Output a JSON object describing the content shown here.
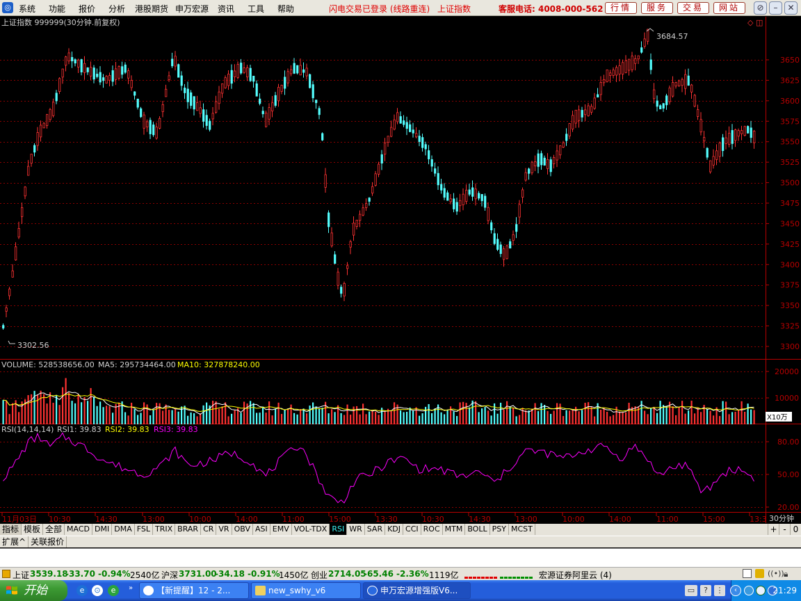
{
  "menubar": {
    "items": [
      "系统",
      "功能",
      "报价",
      "分析",
      "港股期货",
      "申万宏源",
      "资讯",
      "工具",
      "帮助"
    ],
    "flash_status": "闪电交易已登录 (线路重连)",
    "index_name": "上证指数",
    "hotline": "客服电话: 4008-000-562",
    "nav_buttons": [
      "行情",
      "服务",
      "交易",
      "网站"
    ]
  },
  "main_chart": {
    "title": "上证指数 999999(30分钟.前复权)",
    "high_label": "3684.57",
    "low_label": "3302.56",
    "y_ticks": [
      "3650",
      "3625",
      "3600",
      "3575",
      "3550",
      "3525",
      "3500",
      "3475",
      "3450",
      "3425",
      "3400",
      "3375",
      "3350",
      "3325",
      "3300"
    ]
  },
  "volume_panel": {
    "label": "VOLUME: 528538656.00",
    "ma5": "MA5: 295734464.00",
    "ma10": "MA10: 327878240.00",
    "y_ticks": [
      "20000",
      "10000"
    ],
    "unit": "X10万"
  },
  "rsi_panel": {
    "label": "RSI(14,14,14)",
    "rsi1": "RSI1: 39.83",
    "rsi2": "RSI2: 39.83",
    "rsi3": "RSI3: 39.83",
    "y_ticks": [
      "80.00",
      "50.00",
      "20.00"
    ],
    "period": "30分钟"
  },
  "time_axis": [
    "11月03日",
    "10:30",
    "14:30",
    "13:00",
    "10:00",
    "14:00",
    "11:00",
    "15:00",
    "13:30",
    "10:30",
    "14:30",
    "13:00",
    "10:00",
    "14:00",
    "11:00",
    "15:00",
    "13:3"
  ],
  "indicator_tabs": [
    "指标",
    "模板",
    "全部",
    "MACD",
    "DMI",
    "DMA",
    "FSL",
    "TRIX",
    "BRAR",
    "CR",
    "VR",
    "OBV",
    "ASI",
    "EMV",
    "VOL-TDX",
    "RSI",
    "WR",
    "SAR",
    "KDJ",
    "CCI",
    "ROC",
    "MTM",
    "BOLL",
    "PSY",
    "MCST"
  ],
  "active_tab": "RSI",
  "tab_controls": [
    "+",
    "-",
    "0"
  ],
  "ext_tabs": [
    "扩展^",
    "关联报价"
  ],
  "statusbar": {
    "sh_name": "上证",
    "sh_value": "3539.18",
    "sh_change": "-33.70",
    "sh_pct": "-0.94%",
    "sh_amount": "2540亿",
    "hs_name": "沪深",
    "hs_value": "3731.00",
    "hs_change": "-34.18",
    "hs_pct": "-0.91%",
    "hs_amount": "1450亿",
    "cy_name": "创业",
    "cy_value": "2714.05",
    "cy_change": "-65.46",
    "cy_pct": "-2.36%",
    "cy_amount": "1119亿",
    "server": "宏源证券阿里云 (4)"
  },
  "taskbar": {
    "start": "开始",
    "tasks": [
      "【新提醒】12 - 2...",
      "new_swhy_v6",
      "申万宏源增强版V6..."
    ],
    "clock": "21:29"
  },
  "colors": {
    "up": "#ff3232",
    "down": "#54ffff",
    "ma5": "#ffffff",
    "ma10": "#ffff00",
    "rsi": "#ff00ff",
    "grid": "#8b0000",
    "axis": "#b80000"
  }
}
